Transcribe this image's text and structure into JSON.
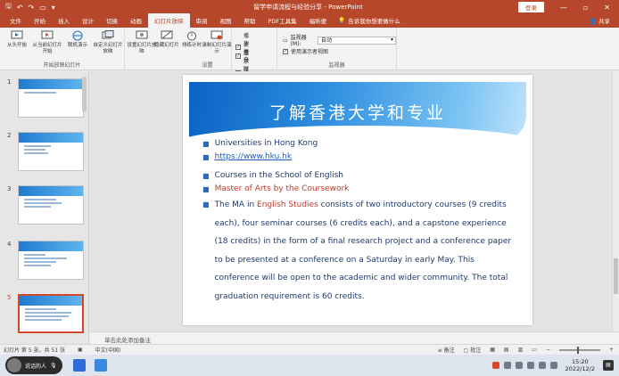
{
  "window": {
    "title": "留学申请流程与经验分享 - PowerPoint",
    "login_label": "登录",
    "controls": [
      "—",
      "▫",
      "✕"
    ]
  },
  "tabs": [
    {
      "label": "文件",
      "active": false
    },
    {
      "label": "开始",
      "active": false
    },
    {
      "label": "插入",
      "active": false
    },
    {
      "label": "设计",
      "active": false
    },
    {
      "label": "切换",
      "active": false
    },
    {
      "label": "动画",
      "active": false
    },
    {
      "label": "幻灯片放映",
      "active": true
    },
    {
      "label": "审阅",
      "active": false
    },
    {
      "label": "视图",
      "active": false
    },
    {
      "label": "帮助",
      "active": false
    },
    {
      "label": "PDF工具集",
      "active": false
    },
    {
      "label": "福昕便",
      "active": false
    }
  ],
  "tell_me": "告诉我你想要做什么",
  "share_label": "共享",
  "ribbon": {
    "buttons": [
      {
        "label": "从头开始"
      },
      {
        "label": "从当前幻灯片开始"
      },
      {
        "label": "联机演示"
      },
      {
        "label": "自定义幻灯片放映"
      },
      {
        "label": "设置幻灯片放映"
      },
      {
        "label": "隐藏幻灯片"
      },
      {
        "label": "排练计时"
      },
      {
        "label": "录制幻灯片演示"
      }
    ],
    "group_labels": [
      "开始放映幻灯片",
      "设置",
      "监视器"
    ],
    "checkboxes": [
      "播放旁白",
      "使用计时",
      "显示媒体控件"
    ],
    "monitor_label": "监视器(M):",
    "monitor_value": "自动",
    "presenter_view": "使用演示者视图"
  },
  "thumbnails": [
    {
      "num": "1",
      "selected": false
    },
    {
      "num": "2",
      "selected": false
    },
    {
      "num": "3",
      "selected": false
    },
    {
      "num": "4",
      "selected": false
    },
    {
      "num": "5",
      "selected": true
    }
  ],
  "slide": {
    "title": "了解香港大学和专业",
    "bullet1": "Universities in Hong Kong",
    "link1": "https://www.hku.hk",
    "bullet2": "Courses in the School of English",
    "bullet3": "Master of Arts by the Coursework",
    "para_pre": "The MA in ",
    "para_red": "English Studies",
    "para_post": " consists of two introductory courses (9 credits each), four seminar courses (6 credits each), and a capstone experience (18 credits) in the form of a final research project and a conference paper to be presented at a conference on a Saturday in early May. This conference will be open to the academic and wider community. The total graduation requirement is 60 credits."
  },
  "notes_placeholder": "单击此处添加备注",
  "status": {
    "slide_count": "幻灯片 第 5 张，共 51 张",
    "language": "中文(中国)",
    "notes": "备注",
    "comments": "批注"
  },
  "taskbar": {
    "meeting_label": "说话的人",
    "time": "15:20",
    "date": "2022/12/2"
  }
}
